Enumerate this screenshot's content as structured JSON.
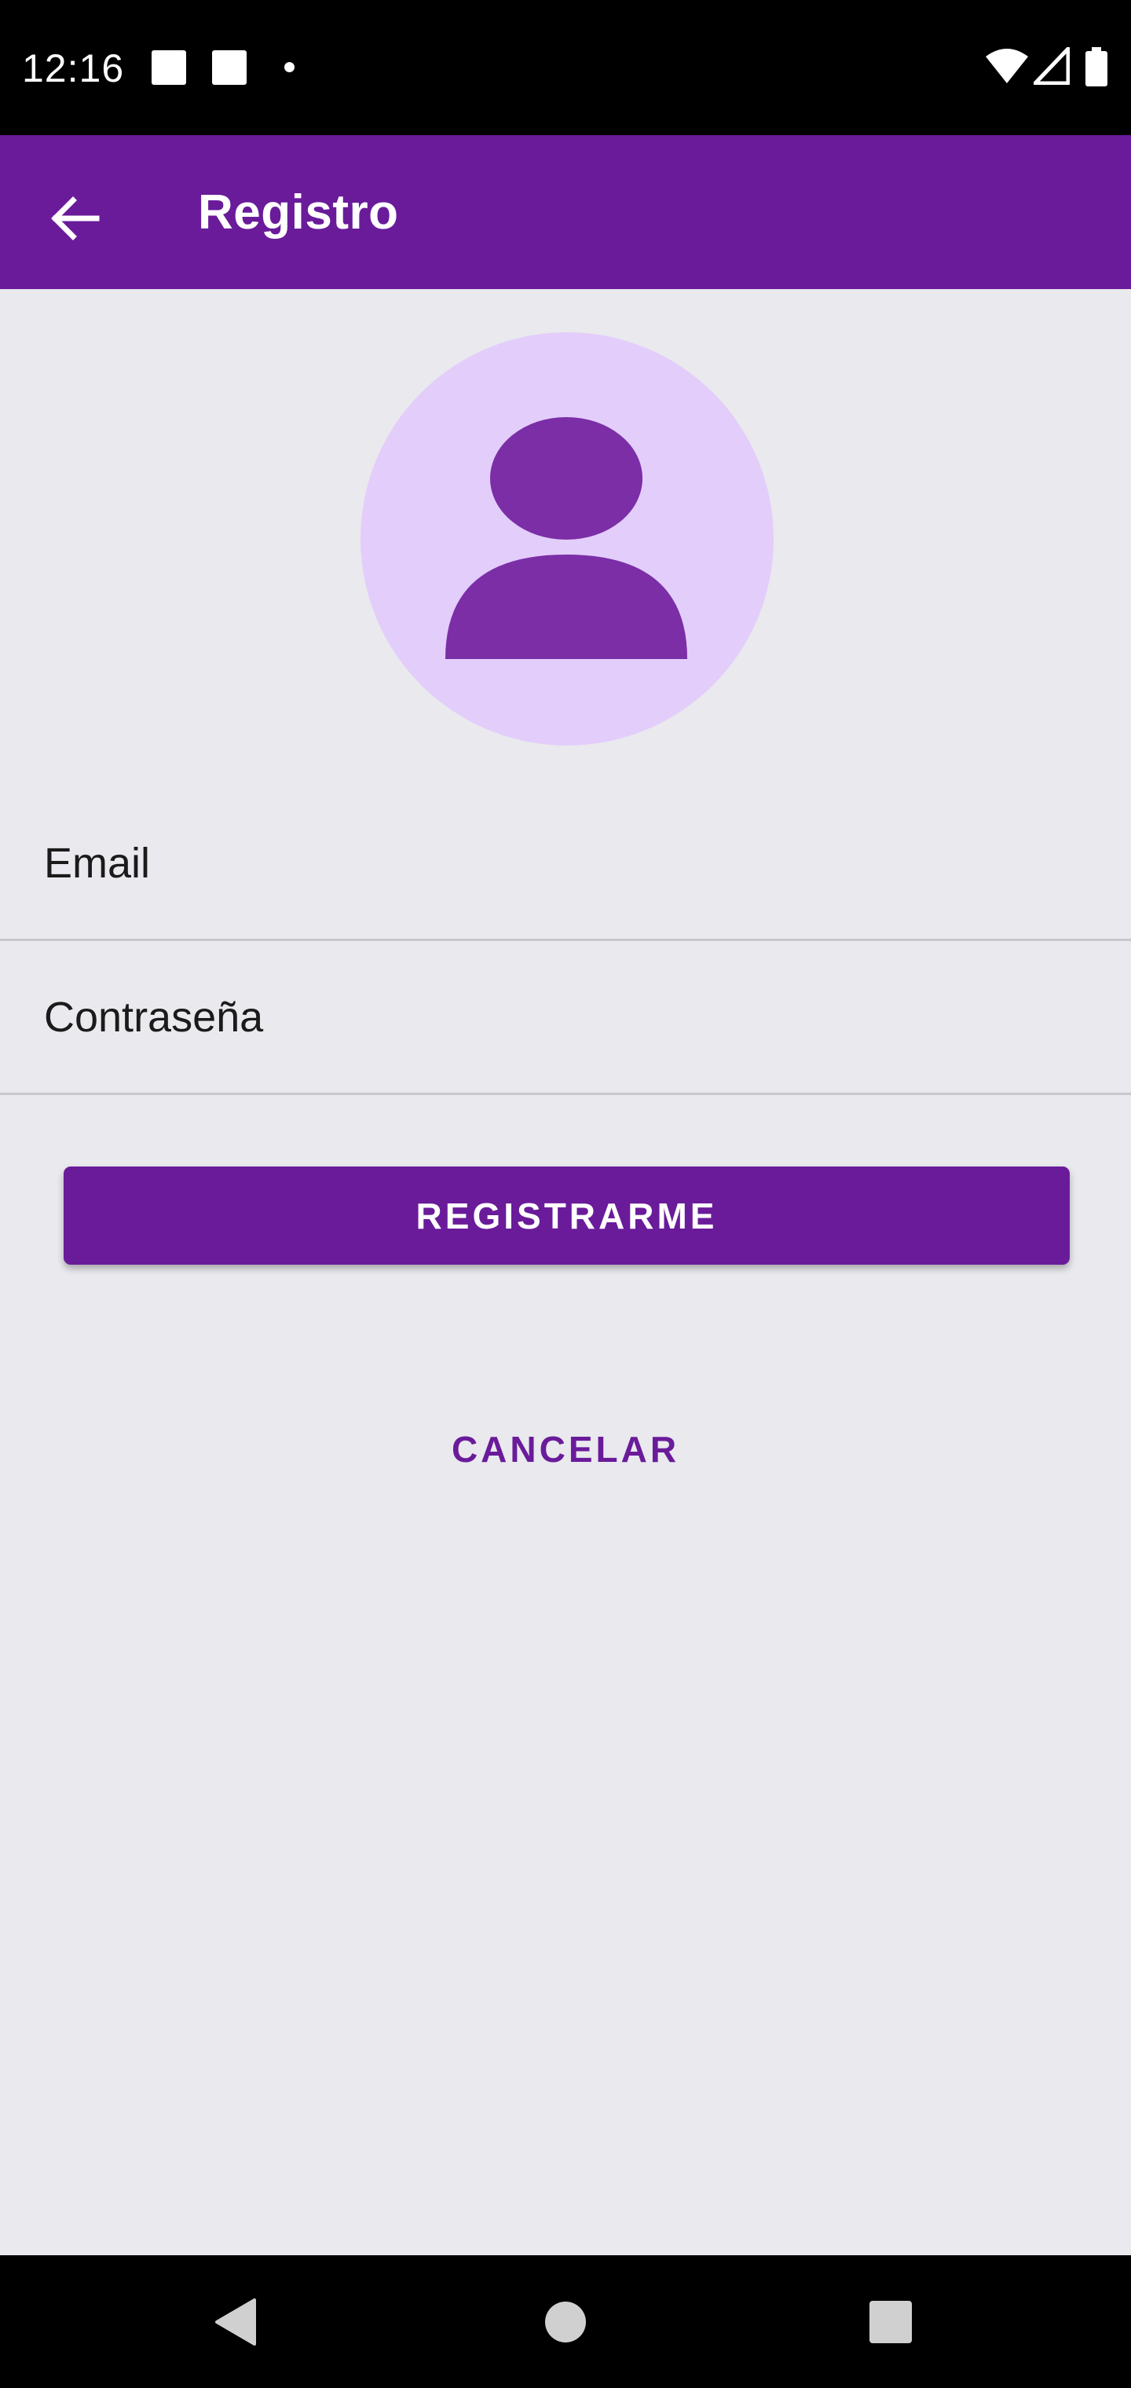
{
  "status_bar": {
    "time": "12:16",
    "icons": [
      "notification-square-icon",
      "notification-square-icon",
      "notification-dot-icon",
      "wifi-icon",
      "cell-signal-icon",
      "battery-icon"
    ]
  },
  "app_bar": {
    "title": "Registro",
    "back_icon": "arrow-back-icon"
  },
  "avatar": {
    "icon": "person-icon",
    "background_color": "#e3cdfb",
    "icon_color": "#7b2ea6"
  },
  "form": {
    "email_placeholder": "Email",
    "email_value": "",
    "password_placeholder": "Contraseña",
    "password_value": ""
  },
  "actions": {
    "register_label": "REGISTRARME",
    "cancel_label": "CANCELAR"
  },
  "colors": {
    "primary": "#6a1b9a",
    "background": "#e9e9ee",
    "divider": "#c7c7cc"
  },
  "nav_bar": {
    "icons": [
      "back-triangle-icon",
      "home-circle-icon",
      "recents-square-icon"
    ]
  }
}
